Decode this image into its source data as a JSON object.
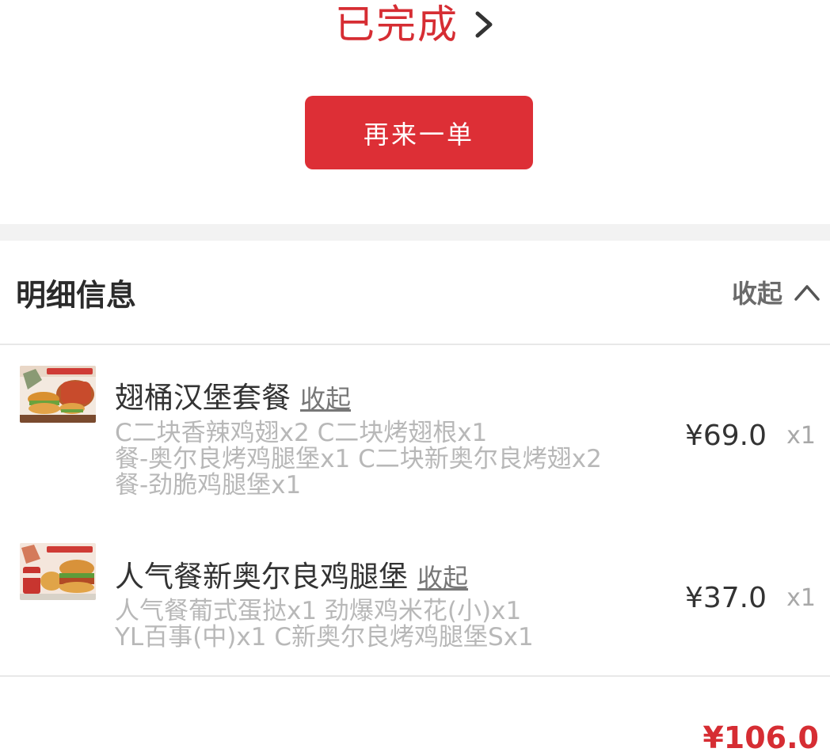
{
  "order": {
    "status": "已完成",
    "reorder_label": "再来一单"
  },
  "details": {
    "title": "明细信息",
    "collapse_label": "收起",
    "items": [
      {
        "name": "翅桶汉堡套餐",
        "collapse_label": "收起",
        "desc_lines": [
          "C二块香辣鸡翅x2 C二块烤翅根x1",
          "餐-奥尔良烤鸡腿堡x1 C二块新奥尔良烤翅x2",
          "餐-劲脆鸡腿堡x1"
        ],
        "price": "¥69.0",
        "qty": "x1",
        "thumb_icon": "wing-bucket-combo-image"
      },
      {
        "name": "人气餐新奥尔良鸡腿堡",
        "collapse_label": "收起",
        "desc_lines": [
          "人气餐葡式蛋挞x1 劲爆鸡米花(小)x1",
          "YL百事(中)x1 C新奥尔良烤鸡腿堡Sx1"
        ],
        "price": "¥37.0",
        "qty": "x1",
        "thumb_icon": "burger-meal-image"
      }
    ],
    "total": "¥106.0"
  },
  "colors": {
    "accent_red": "#d62d33",
    "button_red": "#dd2f36",
    "muted_text": "#b8b8b8"
  }
}
